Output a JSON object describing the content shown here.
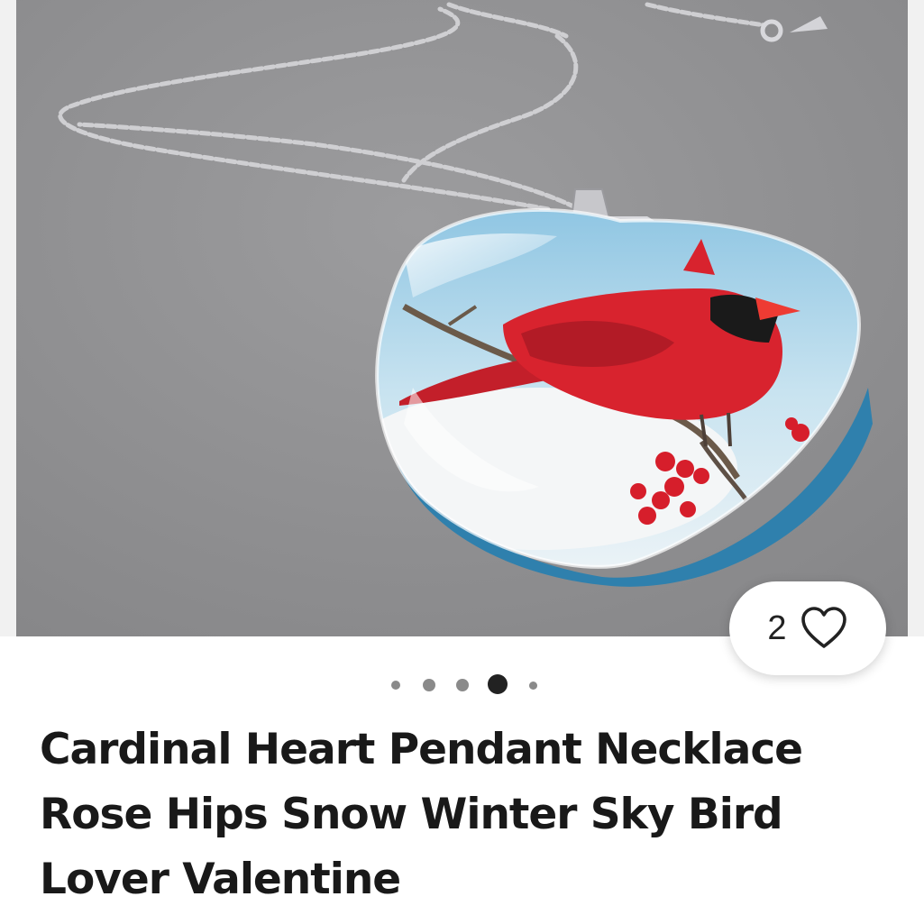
{
  "listing": {
    "title": "Cardinal Heart Pendant Necklace Rose Hips Snow Winter Sky Bird Lover Valentine",
    "image_alt": "Cardinal heart pendant necklace on silver chain"
  },
  "favorites": {
    "count": "2",
    "icon": "heart-outline-icon"
  },
  "carousel": {
    "total_dots": 5,
    "active_index": 3
  },
  "colors": {
    "cardinal_red": "#d8232e",
    "sky_blue": "#a9d3ea",
    "background_gray": "#8c8c8e"
  }
}
